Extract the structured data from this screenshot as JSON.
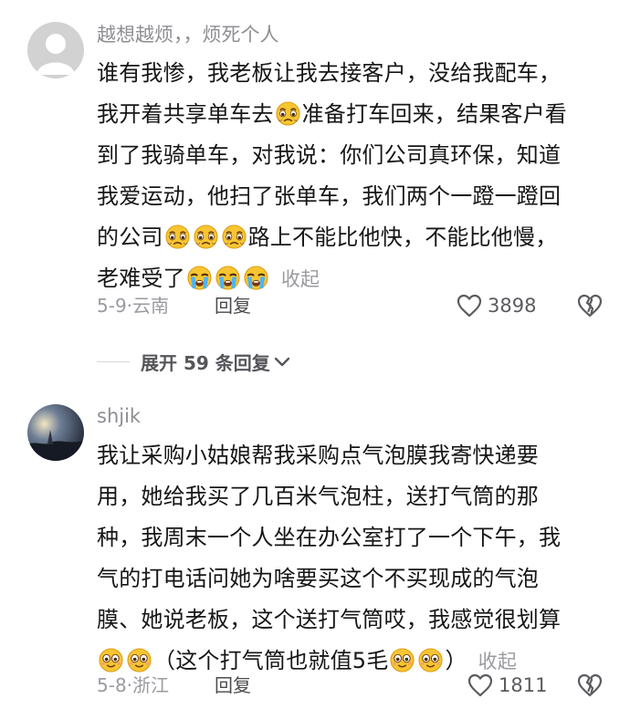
{
  "comments": [
    {
      "username": "越想越烦，，烦死个人",
      "lines": [
        [
          {
            "t": "谁有我惨，我老板让我去接客户，没给我配车，"
          }
        ],
        [
          {
            "t": "我开着共享单车去"
          },
          {
            "e": "crying-emoji"
          },
          {
            "t": "准备打车回来，结果客户看"
          }
        ],
        [
          {
            "t": "到了我骑单车，对我说：你们公司真环保，知道"
          }
        ],
        [
          {
            "t": "我爱运动，他扫了张单车，我们两个一蹬一蹬回"
          }
        ],
        [
          {
            "t": "的公司"
          },
          {
            "e": "crying-emoji"
          },
          {
            "e": "crying-emoji"
          },
          {
            "e": "crying-emoji"
          },
          {
            "t": "路上不能比他快，不能比他慢，"
          }
        ],
        [
          {
            "t": "老难受了"
          },
          {
            "e": "sob-emoji"
          },
          {
            "e": "sob-emoji"
          },
          {
            "e": "sob-emoji"
          },
          {
            "fold": "收起"
          }
        ]
      ],
      "date": "5-9",
      "location": "云南",
      "reply_label": "回复",
      "like_count": "3898"
    },
    {
      "username": "shjik",
      "lines": [
        [
          {
            "t": "我让采购小姑娘帮我采购点气泡膜我寄快递要"
          }
        ],
        [
          {
            "t": "用，她给我买了几百米气泡柱，送打气筒的那"
          }
        ],
        [
          {
            "t": "种，我周末一个人坐在办公室打了一个下午，我"
          }
        ],
        [
          {
            "t": "气的打电话问她为啥要买这个不买现成的气泡"
          }
        ],
        [
          {
            "t": "膜、她说老板，这个送打气筒哎，我感觉很划算"
          }
        ],
        [
          {
            "e": "smile-emoji"
          },
          {
            "e": "smile-emoji"
          },
          {
            "t": "（这个打气筒也就值5毛"
          },
          {
            "e": "smile-emoji"
          },
          {
            "e": "smile-emoji"
          },
          {
            "t": "）"
          },
          {
            "fold": "收起"
          }
        ]
      ],
      "date": "5-8",
      "location": "浙江",
      "reply_label": "回复",
      "like_count": "1811"
    }
  ],
  "expand_replies": {
    "label": "展开 59 条回复"
  },
  "icons": {
    "like": "heart-outline-icon",
    "dislike": "broken-heart-icon",
    "expand": "chevron-down-icon"
  },
  "colors": {
    "text": "#161616",
    "muted": "#9a9aa0",
    "emoji_yellow": "#f7c531"
  }
}
